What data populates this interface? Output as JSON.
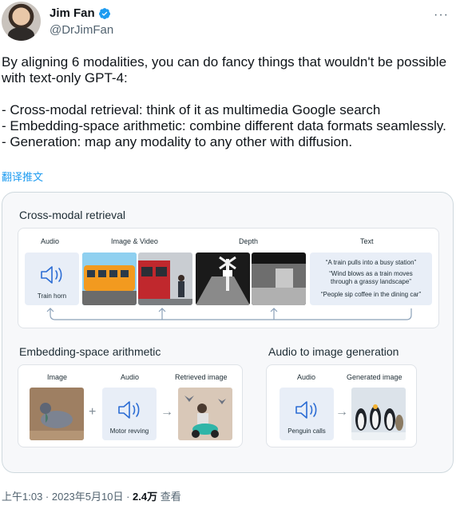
{
  "author": {
    "name": "Jim Fan",
    "handle": "@DrJimFan"
  },
  "tweet": {
    "lines": [
      "By aligning 6 modalities, you can do fancy things that wouldn't be possible with text-only GPT-4:",
      "",
      "- Cross-modal retrieval: think of it as multimedia Google search",
      "- Embedding-space arithmetic: combine different data formats seamlessly.",
      "- Generation: map any modality to any other with diffusion."
    ],
    "translate": "翻译推文"
  },
  "figure": {
    "retrieval": {
      "title": "Cross-modal retrieval",
      "labels": {
        "audio": "Audio",
        "image_video": "Image & Video",
        "depth": "Depth",
        "text": "Text"
      },
      "audio_caption": "Train horn",
      "quotes": [
        "“A train pulls into a busy station”",
        "“Wind blows as a train moves through a grassy landscape”",
        "“People sip coffee in the dining car”"
      ]
    },
    "arithmetic": {
      "title": "Embedding-space arithmetic",
      "labels": {
        "image": "Image",
        "audio": "Audio",
        "retrieved": "Retrieved image"
      },
      "audio_caption": "Motor revving",
      "plus": "+",
      "arrow": "→"
    },
    "generation": {
      "title": "Audio to image generation",
      "labels": {
        "audio": "Audio",
        "generated": "Generated image"
      },
      "audio_caption": "Penguin calls",
      "arrow": "→"
    }
  },
  "footer": {
    "time": "上午1:03 · 2023年5月10日 · ",
    "views_count": "2.4万",
    "views_label": " 查看"
  },
  "colors": {
    "link": "#1d9bf0",
    "verified": "#1d9bf0",
    "secondary": "#536471",
    "audio_bg": "#e8eef7",
    "icon_blue": "#2b6cd4"
  }
}
